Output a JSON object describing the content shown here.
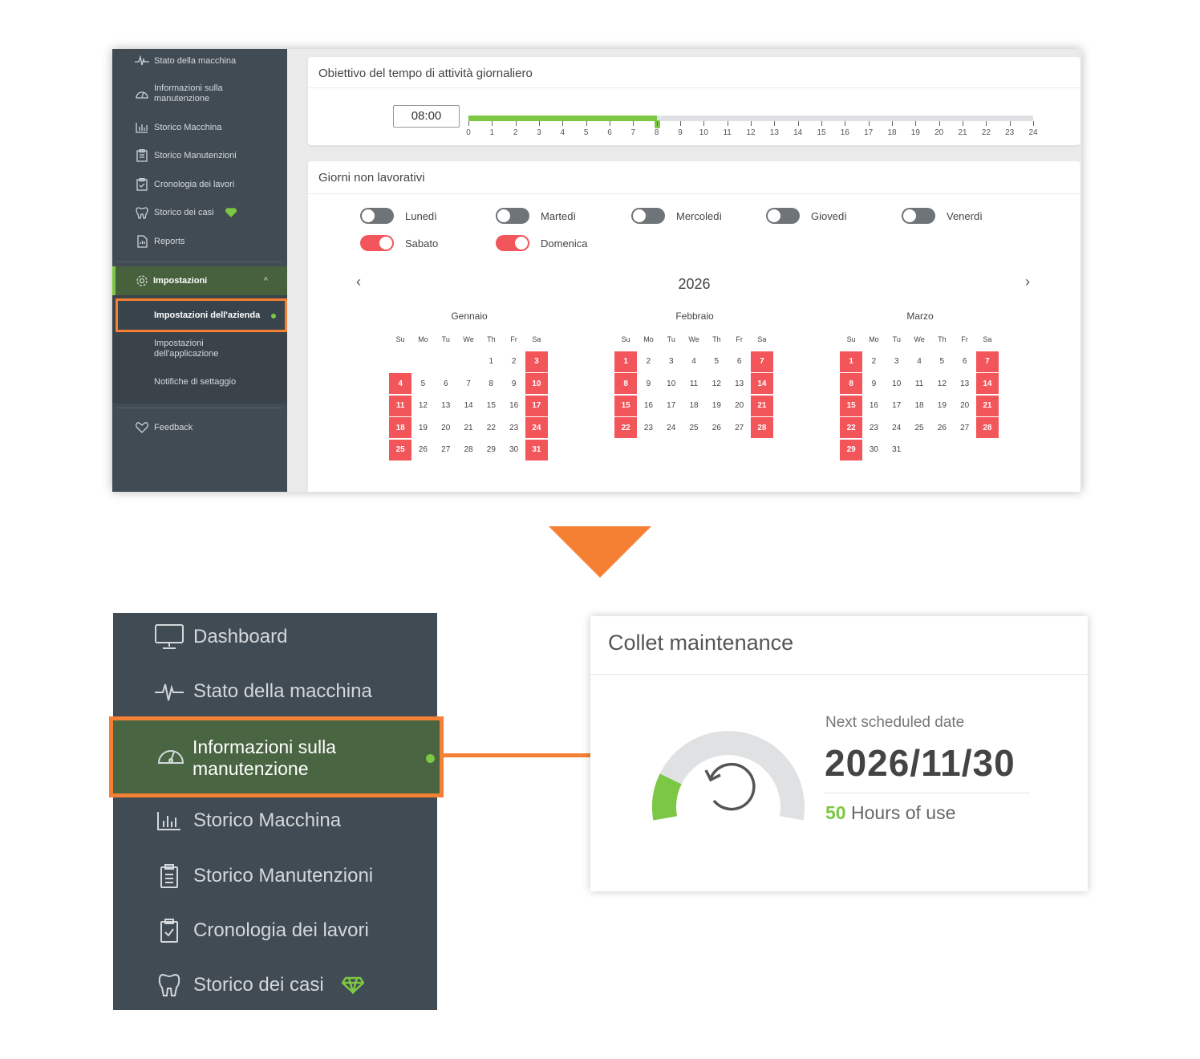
{
  "colors": {
    "accent_orange": "#f58033",
    "active_green": "#7cc744",
    "weekend_red": "#f2555a",
    "sidebar_bg": "#414b53"
  },
  "top": {
    "sidebar": {
      "items": [
        {
          "label": "Stato della macchina",
          "icon": "pulse-icon"
        },
        {
          "label": "Informazioni sulla manutenzione",
          "icon": "gauge-icon"
        },
        {
          "label": "Storico Macchina",
          "icon": "bar-chart-icon"
        },
        {
          "label": "Storico Manutenzioni",
          "icon": "clipboard-list-icon"
        },
        {
          "label": "Cronologia dei lavori",
          "icon": "clipboard-check-icon"
        },
        {
          "label": "Storico dei casi",
          "icon": "tooth-icon"
        },
        {
          "label": "Reports",
          "icon": "document-icon"
        }
      ],
      "settings_label": "Impostazioni",
      "sub_items": [
        "Impostazioni dell'azienda",
        "Impostazioni dell'applicazione",
        "Notifiche di settaggio"
      ],
      "feedback_label": "Feedback"
    },
    "uptime": {
      "title": "Obiettivo del tempo di attività giornaliero",
      "value": "08:00",
      "fill_hours": 8,
      "max_hours": 24,
      "ticks": [
        "0",
        "1",
        "2",
        "3",
        "4",
        "5",
        "6",
        "7",
        "8",
        "9",
        "10",
        "11",
        "12",
        "13",
        "14",
        "15",
        "16",
        "17",
        "18",
        "19",
        "20",
        "21",
        "22",
        "23",
        "24"
      ]
    },
    "non_working": {
      "title": "Giorni non lavorativi",
      "days": [
        {
          "label": "Lunedì",
          "on": false
        },
        {
          "label": "Martedì",
          "on": false
        },
        {
          "label": "Mercoledì",
          "on": false
        },
        {
          "label": "Giovedì",
          "on": false
        },
        {
          "label": "Venerdì",
          "on": false
        },
        {
          "label": "Sabato",
          "on": true
        },
        {
          "label": "Domenica",
          "on": true
        }
      ],
      "year": "2026",
      "prev": "‹",
      "next": "›",
      "dow": [
        "Su",
        "Mo",
        "Tu",
        "We",
        "Th",
        "Fr",
        "Sa"
      ],
      "months": [
        {
          "name": "Gennaio",
          "offset": 4,
          "days": 31
        },
        {
          "name": "Febbraio",
          "offset": 0,
          "days": 28
        },
        {
          "name": "Marzo",
          "offset": 0,
          "days": 31
        }
      ]
    }
  },
  "bottom": {
    "sidebar": {
      "items": [
        {
          "label": "Dashboard",
          "icon": "monitor-icon"
        },
        {
          "label": "Stato della macchina",
          "icon": "pulse-icon"
        },
        {
          "label": "Informazioni sulla manutenzione",
          "icon": "gauge-icon"
        },
        {
          "label": "Storico Macchina",
          "icon": "bar-chart-icon"
        },
        {
          "label": "Storico Manutenzioni",
          "icon": "clipboard-list-icon"
        },
        {
          "label": "Cronologia dei lavori",
          "icon": "clipboard-check-icon"
        },
        {
          "label": "Storico dei casi",
          "icon": "tooth-icon"
        }
      ]
    },
    "collet": {
      "title": "Collet maintenance",
      "next_label": "Next scheduled date",
      "date": "2026/11/30",
      "hours_value": "50",
      "hours_label": "Hours of use",
      "gauge_fraction": 0.18
    }
  }
}
